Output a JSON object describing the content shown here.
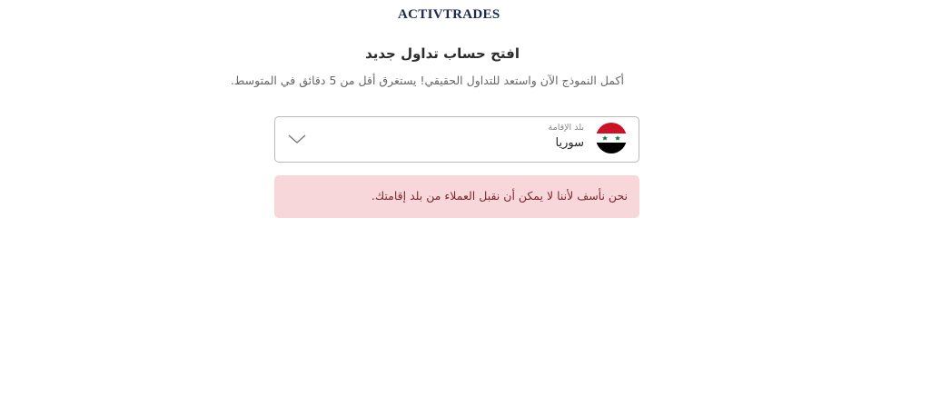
{
  "brand": {
    "logo_text": "ACTIVTRADES",
    "color": "#1b2a4e"
  },
  "form": {
    "title": "افتح حساب تداول جديد",
    "subtitle": "أكمل النموذج الآن واستعد للتداول الحقيقي! يستغرق أقل من 5 دقائق في المتوسط.",
    "country_field": {
      "label": "بلد الإقامة",
      "value": "سوريا",
      "flag_icon": "syria-flag-icon"
    }
  },
  "alert": {
    "message": "نحن نأسف لأننا لا يمكن أن نقبل العملاء من بلد إقامتك.",
    "background": "#f8d7da",
    "text_color": "#7a2a2f"
  }
}
